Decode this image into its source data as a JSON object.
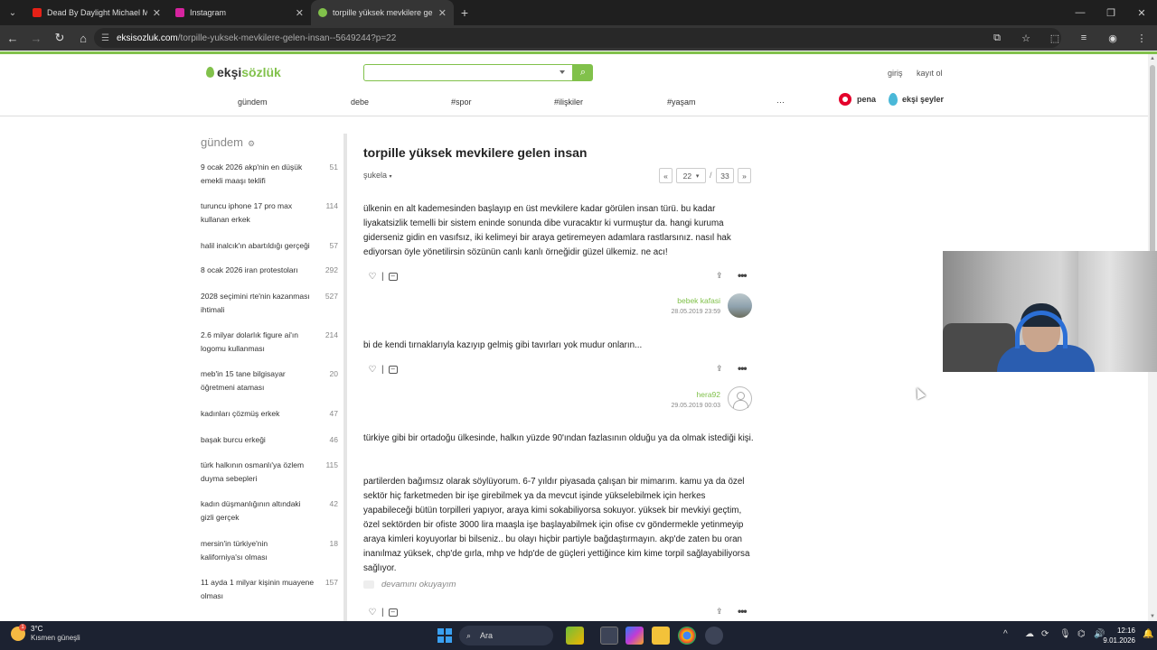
{
  "browser": {
    "tabs": [
      {
        "title": "Dead By Daylight Michael Mye",
        "color": "#e62117"
      },
      {
        "title": "Instagram",
        "color": "#d6249f"
      },
      {
        "title": "torpille yüksek mevkilere gelen",
        "color": "#81c14b"
      }
    ],
    "url_domain": "eksisozluk.com",
    "url_path": "/torpille-yuksek-mevkilere-gelen-insan--5649244?p=22"
  },
  "site": {
    "logo_prefix": "ekşi",
    "logo_suffix": "sözlük",
    "login": "giriş",
    "register": "kayıt ol",
    "nav": [
      "gündem",
      "debe",
      "#spor",
      "#ilişkiler",
      "#yaşam",
      "···"
    ],
    "pena": "pena",
    "seyler": "ekşi şeyler"
  },
  "sidebar": {
    "title": "gündem",
    "items": [
      {
        "title": "9 ocak 2026 akp'nin en düşük emekli maaşı teklifi",
        "count": "51"
      },
      {
        "title": "turuncu iphone 17 pro max kullanan erkek",
        "count": "114"
      },
      {
        "title": "halil inalcık'ın abartıldığı gerçeği",
        "count": "57"
      },
      {
        "title": "8 ocak 2026 iran protestoları",
        "count": "292"
      },
      {
        "title": "2028 seçimini rte'nin kazanması ihtimali",
        "count": "527"
      },
      {
        "title": "2.6 milyar dolarlık figure ai'ın logomu kullanması",
        "count": "214"
      },
      {
        "title": "meb'in 15 tane bilgisayar öğretmeni ataması",
        "count": "20"
      },
      {
        "title": "kadınları çözmüş erkek",
        "count": "47"
      },
      {
        "title": "başak burcu erkeği",
        "count": "46"
      },
      {
        "title": "türk halkının osmanlı'ya özlem duyma sebepleri",
        "count": "115"
      },
      {
        "title": "kadın düşmanlığının altındaki gizli gerçek",
        "count": "42"
      },
      {
        "title": "mersin'in türkiye'nin kaliforniya'sı olması",
        "count": "18"
      },
      {
        "title": "11 ayda 1 milyar kişinin muayene olması",
        "count": "157"
      }
    ]
  },
  "topic": {
    "title": "torpille yüksek mevkilere gelen insan",
    "sort": "şukela",
    "page_current": "22",
    "page_total": "33",
    "prev": "«",
    "next": "»",
    "sep": "/"
  },
  "entries": [
    {
      "paragraphs": [
        "ülkenin en alt kademesinden başlayıp en üst mevkilere kadar görülen insan türü. bu kadar liyakatsizlik temelli bir sistem eninde sonunda dibe vuracaktır ki vurmuştur da. hangi kuruma giderseniz gidin en vasıfsız, iki kelimeyi bir araya getiremeyen adamlara rastlarsınız. nasıl hak ediyorsan öyle yönetilirsin sözünün canlı kanlı örneğidir güzel ülkemiz. ne acı!"
      ],
      "author": "bebek kafasi",
      "date": "28.05.2019 23:59"
    },
    {
      "paragraphs": [
        "bi de kendi tırnaklarıyla kazıyıp gelmiş gibi tavırları yok mudur onların..."
      ],
      "author": "hera92",
      "date": "29.05.2019 00:03"
    },
    {
      "paragraphs": [
        "türkiye gibi bir ortadoğu ülkesinde, halkın yüzde 90'ından fazlasının olduğu ya da olmak istediği kişi.",
        "partilerden bağımsız olarak söylüyorum. 6-7 yıldır piyasada çalışan bir mimarım. kamu ya da özel sektör hiç farketmeden bir işe girebilmek ya da mevcut işinde yükselebilmek için herkes yapabileceği bütün torpilleri yapıyor, araya kimi sokabiliyorsa sokuyor. yüksek bir mevkiyi geçtim, özel sektörden bir ofiste 3000 lira maaşla işe başlayabilmek için ofise cv göndermekle yetinmeyip araya kimleri koyuyorlar bi bilseniz.. bu olayı hiçbir partiyle bağdaştırmayın. akp'de zaten bu oran inanılmaz yüksek, chp'de gırla, mhp ve hdp'de de güçleri yettiğince kim kime torpil sağlayabiliyorsa sağlıyor."
      ],
      "read_more": "devamını okuyayım"
    }
  ],
  "taskbar": {
    "weather_temp": "3°C",
    "weather_cond": "Kısmen güneşli",
    "search": "Ara",
    "time": "12:16",
    "date": "9.01.2026"
  }
}
